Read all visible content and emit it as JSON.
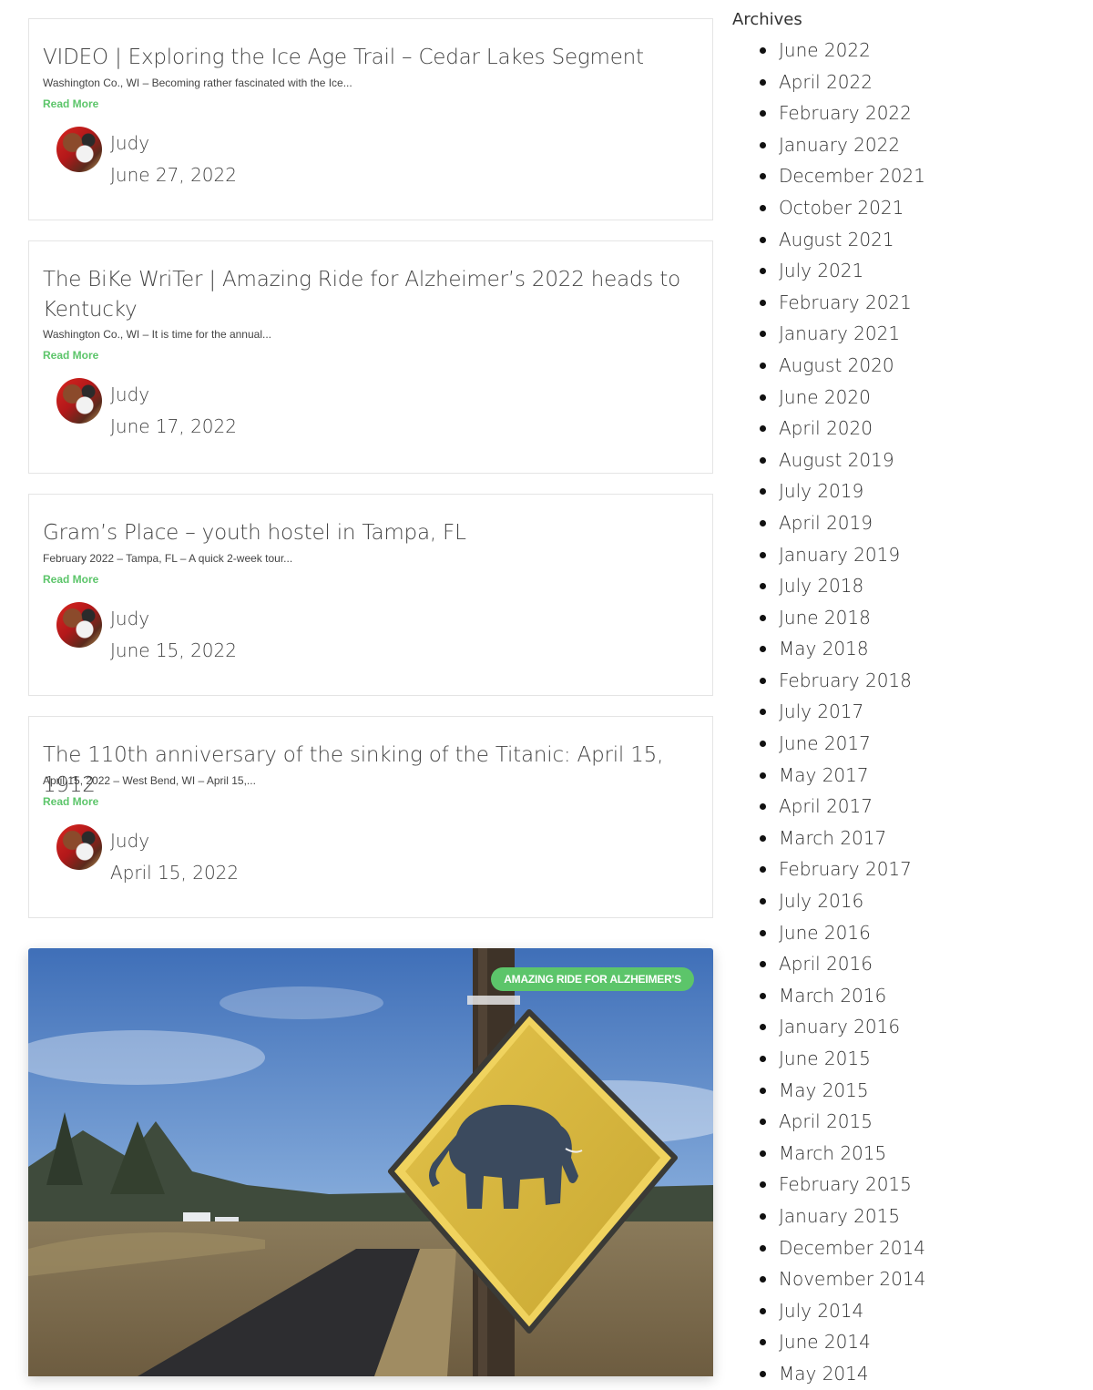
{
  "posts": [
    {
      "title": "VIDEO | Exploring the Ice Age Trail – Cedar Lakes Segment",
      "excerpt": "Washington Co., WI – Becoming rather fascinated with the Ice...",
      "read_more": "Read More",
      "author": "Judy",
      "date": "June 27, 2022"
    },
    {
      "title": "The BiKe WriTer | Amazing Ride for Alzheimer’s 2022 heads to Kentucky",
      "excerpt": "Washington Co., WI – It is time for the annual...",
      "read_more": "Read More",
      "author": "Judy",
      "date": "June 17, 2022"
    },
    {
      "title": "Gram’s Place – youth hostel in Tampa, FL",
      "excerpt": "February 2022 – Tampa, FL – A quick 2-week tour...",
      "read_more": "Read More",
      "author": "Judy",
      "date": "June 15, 2022"
    },
    {
      "title": "The 110th anniversary of the sinking of the Titanic: April 15, 1912",
      "excerpt": "April 15, 2022 – West Bend, WI – April 15,...",
      "read_more": "Read More",
      "author": "Judy",
      "date": "April 15, 2022"
    }
  ],
  "featured": {
    "tag": "AMAZING RIDE FOR ALZHEIMER'S",
    "image_subject": "mammoth-crossing-sign-photo"
  },
  "sidebar": {
    "archives_title": "Archives",
    "archives": [
      "June 2022",
      "April 2022",
      "February 2022",
      "January 2022",
      "December 2021",
      "October 2021",
      "August 2021",
      "July 2021",
      "February 2021",
      "January 2021",
      "August 2020",
      "June 2020",
      "April 2020",
      "August 2019",
      "July 2019",
      "April 2019",
      "January 2019",
      "July 2018",
      "June 2018",
      "May 2018",
      "February 2018",
      "July 2017",
      "June 2017",
      "May 2017",
      "April 2017",
      "March 2017",
      "February 2017",
      "July 2016",
      "June 2016",
      "April 2016",
      "March 2016",
      "January 2016",
      "June 2015",
      "May 2015",
      "April 2015",
      "March 2015",
      "February 2015",
      "January 2015",
      "December 2014",
      "November 2014",
      "July 2014",
      "June 2014",
      "May 2014"
    ]
  },
  "colors": {
    "accent_green": "#5cc56a",
    "card_border": "#e4e4e4",
    "text": "#444444"
  }
}
